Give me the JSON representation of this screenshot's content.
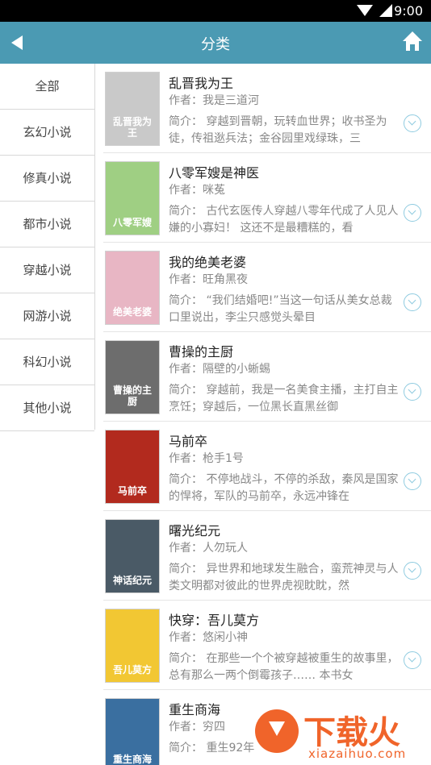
{
  "status_bar": {
    "time": "9:00"
  },
  "app_bar": {
    "title": "分类"
  },
  "categories": [
    "全部",
    "玄幻小说",
    "修真小说",
    "都市小说",
    "穿越小说",
    "网游小说",
    "科幻小说",
    "其他小说"
  ],
  "books": [
    {
      "title": "乱晋我为王",
      "author": "作者：我是三道河",
      "intro": "简介： 穿越到晋朝，玩转血世界；收书圣为徒，传祖逖兵法；金谷园里戏绿珠，三",
      "cover_text": "乱晋我为王",
      "cover_color": "#c9c9c9"
    },
    {
      "title": "八零军嫂是神医",
      "author": "作者：咪菟",
      "intro": "简介： 古代玄医传人穿越八零年代成了人见人嫌的小寡妇！ 这还不是最糟糕的，看",
      "cover_text": "八零军嫂",
      "cover_color": "#9fcf83"
    },
    {
      "title": "我的绝美老婆",
      "author": "作者：旺角黑夜",
      "intro": "简介： “我们结婚吧!”当这一句话从美女总裁口里说出，李尘只感觉头晕目",
      "cover_text": "绝美老婆",
      "cover_color": "#e8b6c4"
    },
    {
      "title": "曹操的主厨",
      "author": "作者：隔壁的小蜥蜴",
      "intro": "简介： 穿越前，我是一名美食主播，主打自主烹饪；穿越后，一位黑长直黑丝御",
      "cover_text": "曹操的主厨",
      "cover_color": "#6d6d6d"
    },
    {
      "title": "马前卒",
      "author": "作者：枪手1号",
      "intro": "简介： 不停地战斗，不停的杀敌，秦风是国家的悍将，军队的马前卒，永远冲锋在",
      "cover_text": "马前卒",
      "cover_color": "#b22a1e"
    },
    {
      "title": "曙光纪元",
      "author": "作者：人勿玩人",
      "intro": "简介： 异世界和地球发生融合，蛮荒神灵与人类文明都对彼此的世界虎视眈眈，然",
      "cover_text": "神话纪元",
      "cover_color": "#4a5a66"
    },
    {
      "title": "快穿：吾儿莫方",
      "author": "作者：悠闲小神",
      "intro": "简介： 在那些一个个被穿越被重生的故事里，总有那么一两个倒霉孩子…… 本书女",
      "cover_text": "吾儿莫方",
      "cover_color": "#f2c733"
    },
    {
      "title": "重生商海",
      "author": "作者：穷四",
      "intro": "简介： 重生92年",
      "cover_text": "重生商海",
      "cover_color": "#3a6fa0"
    }
  ],
  "watermark": {
    "text": "下载火",
    "domain": "xiazaihuo.com",
    "color": "#f0642a"
  }
}
